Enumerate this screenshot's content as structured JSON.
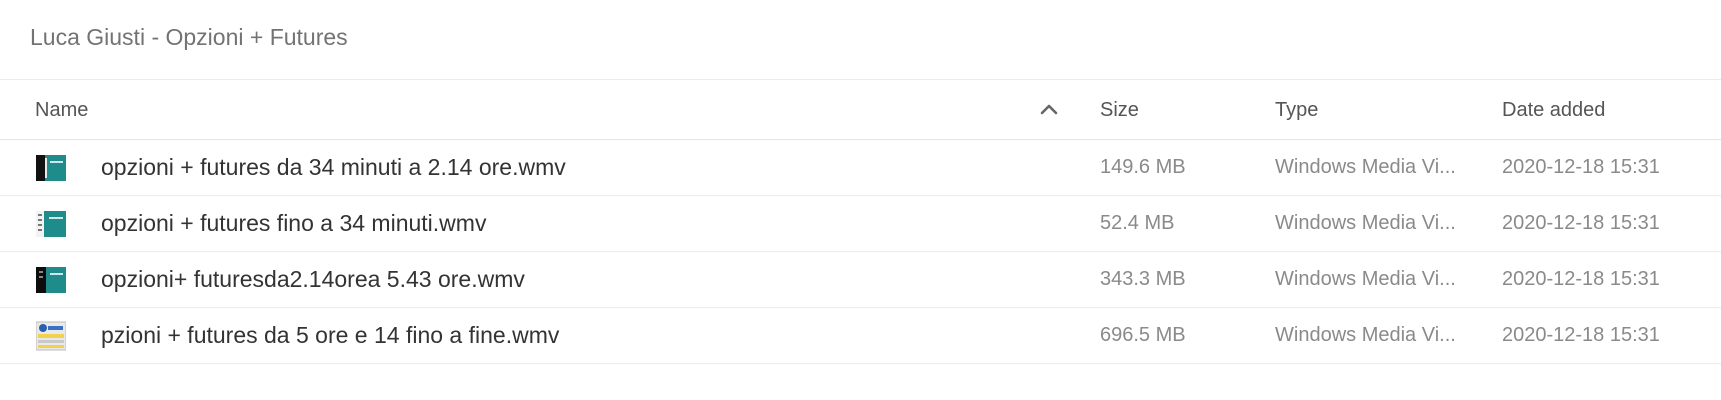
{
  "folder": {
    "title": "Luca Giusti - Opzioni + Futures"
  },
  "columns": {
    "name": "Name",
    "size": "Size",
    "type": "Type",
    "date_added": "Date added",
    "sort_icon": "chevron-up-icon"
  },
  "files": [
    {
      "name": "opzioni + futures da 34 minuti a 2.14 ore.wmv",
      "size": "149.6 MB",
      "type": "Windows Media Vi...",
      "date_added": "2020-12-18 15:31",
      "icon": "video-thumbnail-icon"
    },
    {
      "name": "opzioni + futures fino a 34 minuti.wmv",
      "size": "52.4 MB",
      "type": "Windows Media Vi...",
      "date_added": "2020-12-18 15:31",
      "icon": "video-thumbnail-icon"
    },
    {
      "name": "opzioni+ futuresda2.14orea 5.43 ore.wmv",
      "size": "343.3 MB",
      "type": "Windows Media Vi...",
      "date_added": "2020-12-18 15:31",
      "icon": "video-thumbnail-icon"
    },
    {
      "name": "pzioni + futures da 5 ore e 14 fino a fine.wmv",
      "size": "696.5 MB",
      "type": "Windows Media Vi...",
      "date_added": "2020-12-18 15:31",
      "icon": "video-thumbnail-icon"
    }
  ],
  "colors": {
    "thumbnail_teal": "#1e8c8a",
    "thumbnail_dark": "#111111"
  }
}
